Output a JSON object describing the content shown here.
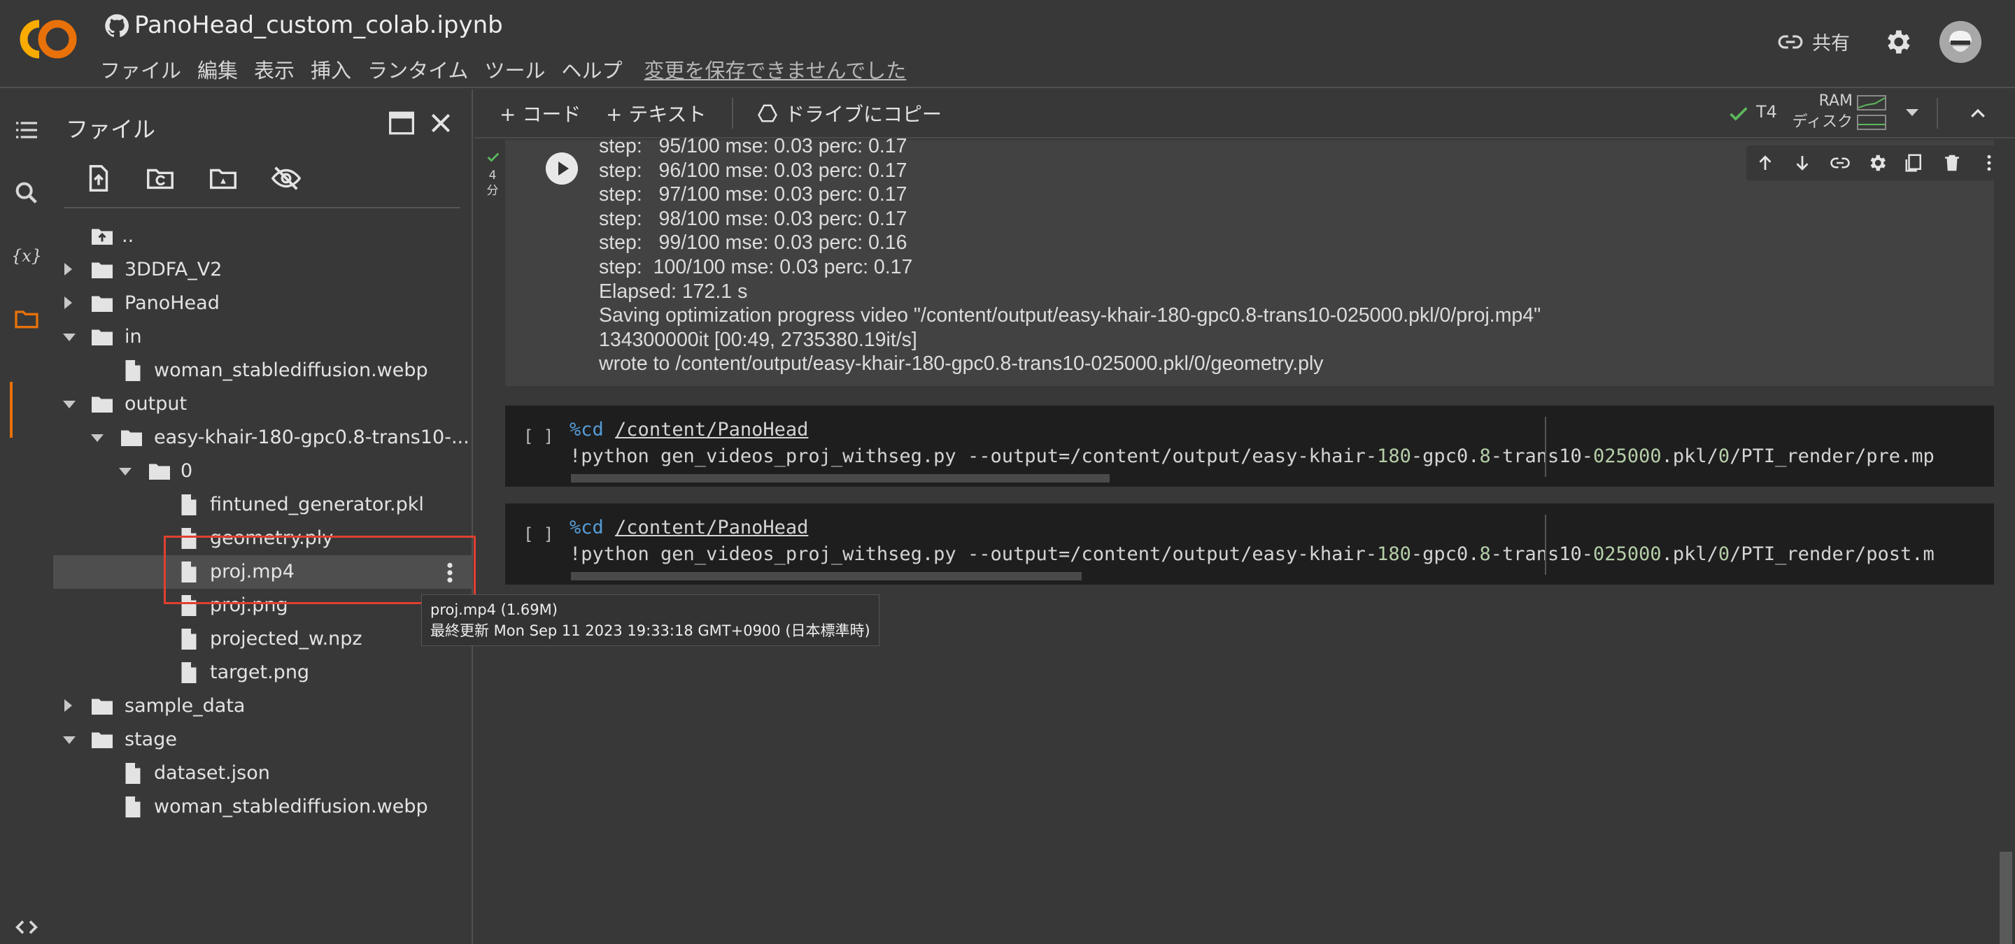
{
  "header": {
    "title": "PanoHead_custom_colab.ipynb",
    "menu": [
      "ファイル",
      "編集",
      "表示",
      "挿入",
      "ランタイム",
      "ツール",
      "ヘルプ"
    ],
    "unsaved": "変更を保存できませんでした",
    "share": "共有"
  },
  "files": {
    "title": "ファイル",
    "rows": [
      {
        "label": ".."
      },
      {
        "label": "3DDFA_V2"
      },
      {
        "label": "PanoHead"
      },
      {
        "label": "in"
      },
      {
        "label": "woman_stablediffusion.webp"
      },
      {
        "label": "output"
      },
      {
        "label": "easy-khair-180-gpc0.8-trans10-..."
      },
      {
        "label": "0"
      },
      {
        "label": "fintuned_generator.pkl"
      },
      {
        "label": "geometry.ply"
      },
      {
        "label": "proj.mp4"
      },
      {
        "label": "proj.png"
      },
      {
        "label": "projected_w.npz"
      },
      {
        "label": "target.png"
      },
      {
        "label": "sample_data"
      },
      {
        "label": "stage"
      },
      {
        "label": "dataset.json"
      },
      {
        "label": "woman_stablediffusion.webp"
      }
    ],
    "tooltip": {
      "line1": "proj.mp4 (1.69M)",
      "line2": "最終更新 Mon Sep 11 2023 19:33:18 GMT+0900 (日本標準時)"
    }
  },
  "toolbar": {
    "code": "+ コード",
    "text": "+ テキスト",
    "drive": "ドライブにコピー",
    "runtime": "T4",
    "ram": "RAM",
    "disk": "ディスク"
  },
  "cell1": {
    "exec_time": "4\n分",
    "output": "step:   95/100 mse: 0.03 perc: 0.17\nstep:   96/100 mse: 0.03 perc: 0.17\nstep:   97/100 mse: 0.03 perc: 0.17\nstep:   98/100 mse: 0.03 perc: 0.17\nstep:   99/100 mse: 0.03 perc: 0.16\nstep:  100/100 mse: 0.03 perc: 0.17\nElapsed: 172.1 s\nSaving optimization progress video \"/content/output/easy-khair-180-gpc0.8-trans10-025000.pkl/0/proj.mp4\"\n134300000it [00:49, 2735380.19it/s]\nwrote to /content/output/easy-khair-180-gpc0.8-trans10-025000.pkl/0/geometry.ply"
  },
  "cell2": {
    "bracket": "[ ]",
    "magic": "%cd",
    "path": "/content/PanoHead",
    "cmd_a": "!python gen_videos_proj_withseg.py --output=/content/output/easy-khair-",
    "n1": "180",
    "cmd_b": "-gpc0.",
    "n2": "8",
    "cmd_c": "-trans10-",
    "n3": "025000",
    "cmd_d": ".pkl/",
    "n4": "0",
    "cmd_e": "/PTI_render/pre.mp"
  },
  "cell3": {
    "bracket": "[ ]",
    "magic": "%cd",
    "path": "/content/PanoHead",
    "cmd_a": "!python gen_videos_proj_withseg.py --output=/content/output/easy-khair-",
    "n1": "180",
    "cmd_b": "-gpc0.",
    "n2": "8",
    "cmd_c": "-trans10-",
    "n3": "025000",
    "cmd_d": ".pkl/",
    "n4": "0",
    "cmd_e": "/PTI_render/post.m"
  },
  "colors": {
    "accent": "#e8710a",
    "bg": "#383838",
    "selection": "#e0402f"
  }
}
